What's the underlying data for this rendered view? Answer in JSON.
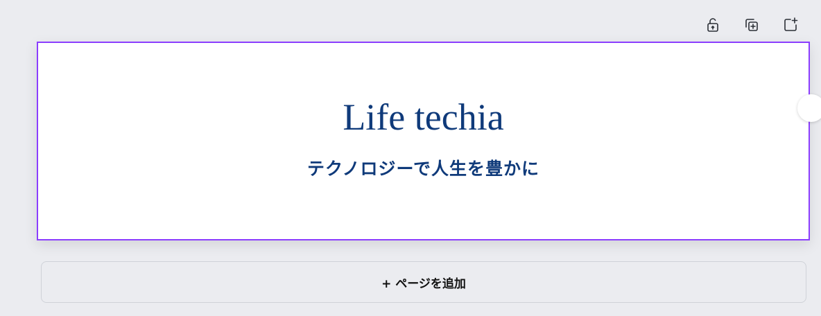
{
  "toolbar": {
    "icons": [
      "lock-open-icon",
      "duplicate-page-icon",
      "add-page-icon"
    ]
  },
  "design_page": {
    "title": "Life techia",
    "subtitle": "テクノロジーで人生を豊かに",
    "selection_color": "#8b3dff",
    "text_color": "#0f3a7a"
  },
  "add_page_button": {
    "label": "+ ページを追加"
  }
}
